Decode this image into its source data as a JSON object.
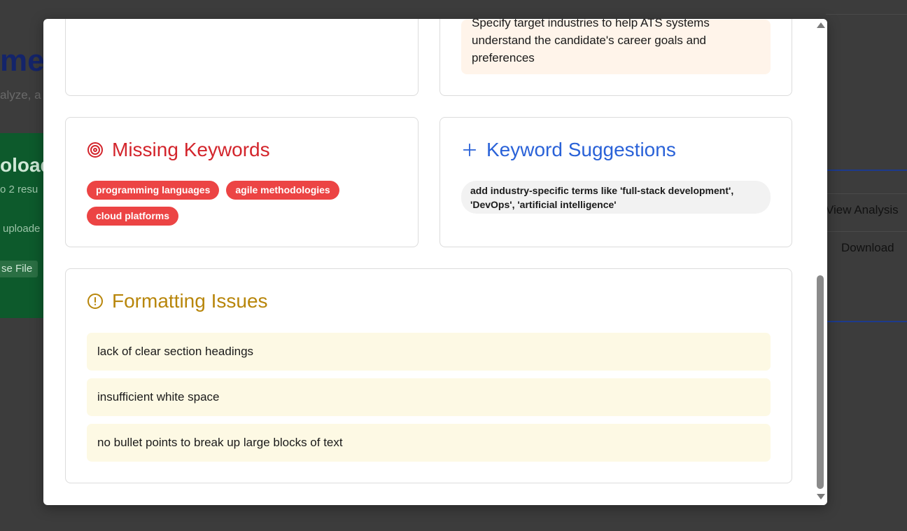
{
  "background": {
    "title_fragment": "me",
    "subtitle_fragment": "alyze, a",
    "upload_title_fragment": "oload",
    "upload_sub_fragment": "o 2 resu",
    "upload_note_fragment": "uploade",
    "choose_file_fragment": "se File",
    "view_analysis_label": "View Analysis",
    "download_label": "Download"
  },
  "modal": {
    "target_industries_text": "Specify target industries to help ATS systems understand the candidate's career goals and preferences",
    "missing_keywords": {
      "title": "Missing Keywords",
      "icon": "target-icon",
      "tags": [
        "programming languages",
        "agile methodologies",
        "cloud platforms"
      ]
    },
    "keyword_suggestions": {
      "title": "Keyword Suggestions",
      "icon": "plus-icon",
      "items": [
        "add industry-specific terms like 'full-stack development', 'DevOps', 'artificial intelligence'"
      ]
    },
    "formatting_issues": {
      "title": "Formatting Issues",
      "icon": "alert-circle-icon",
      "items": [
        "lack of clear section headings",
        "insufficient white space",
        "no bullet points to break up large blocks of text"
      ]
    }
  },
  "colors": {
    "missing_accent": "#d3252c",
    "suggest_accent": "#2a62d8",
    "format_accent": "#b8860b",
    "tag_bg": "#ec4444"
  }
}
